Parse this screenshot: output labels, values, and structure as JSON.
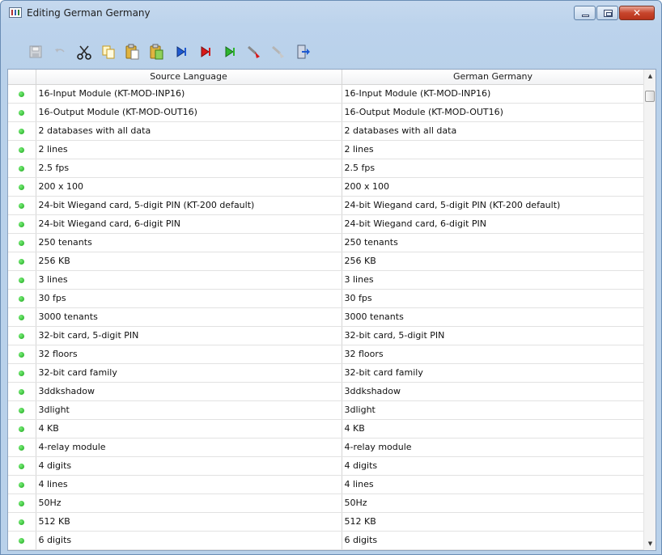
{
  "window": {
    "title": "Editing German Germany",
    "close_glyph": "✕"
  },
  "toolbar": {
    "buttons": [
      {
        "name": "save-icon",
        "enabled": false
      },
      {
        "name": "undo-icon",
        "enabled": false
      },
      {
        "name": "cut-icon",
        "enabled": true
      },
      {
        "name": "copy-icon",
        "enabled": true
      },
      {
        "name": "paste-icon",
        "enabled": true
      },
      {
        "name": "paste-special-icon",
        "enabled": true
      },
      {
        "name": "next-blue-icon",
        "enabled": true
      },
      {
        "name": "next-red-icon",
        "enabled": true
      },
      {
        "name": "next-green-icon",
        "enabled": true
      },
      {
        "name": "mark-icon",
        "enabled": true
      },
      {
        "name": "unmark-icon",
        "enabled": false
      },
      {
        "name": "exit-icon",
        "enabled": true
      }
    ]
  },
  "grid": {
    "headers": {
      "source": "Source Language",
      "target": "German Germany"
    },
    "scroll": {
      "up": "▲",
      "down": "▼"
    },
    "rows": [
      {
        "source": "16-Input Module (KT-MOD-INP16)",
        "target": "16-Input Module (KT-MOD-INP16)"
      },
      {
        "source": "16-Output Module (KT-MOD-OUT16)",
        "target": "16-Output Module (KT-MOD-OUT16)"
      },
      {
        "source": "2 databases with all data",
        "target": "2 databases with all data"
      },
      {
        "source": "2 lines",
        "target": "2 lines"
      },
      {
        "source": "2.5 fps",
        "target": "2.5 fps"
      },
      {
        "source": "200 x 100",
        "target": "200 x 100"
      },
      {
        "source": "24-bit Wiegand card, 5-digit PIN (KT-200 default)",
        "target": "24-bit Wiegand card, 5-digit PIN (KT-200 default)"
      },
      {
        "source": "24-bit Wiegand card, 6-digit PIN",
        "target": "24-bit Wiegand card, 6-digit PIN"
      },
      {
        "source": "250 tenants",
        "target": "250 tenants"
      },
      {
        "source": "256 KB",
        "target": "256 KB"
      },
      {
        "source": "3 lines",
        "target": "3 lines"
      },
      {
        "source": "30 fps",
        "target": "30 fps"
      },
      {
        "source": "3000 tenants",
        "target": "3000 tenants"
      },
      {
        "source": "32-bit card, 5-digit PIN",
        "target": "32-bit card, 5-digit PIN"
      },
      {
        "source": "32 floors",
        "target": "32 floors"
      },
      {
        "source": "32-bit card family",
        "target": "32-bit card family"
      },
      {
        "source": "3ddkshadow",
        "target": "3ddkshadow"
      },
      {
        "source": "3dlight",
        "target": "3dlight"
      },
      {
        "source": "4 KB",
        "target": "4 KB"
      },
      {
        "source": "4-relay module",
        "target": "4-relay module"
      },
      {
        "source": "4 digits",
        "target": "4 digits"
      },
      {
        "source": "4 lines",
        "target": "4 lines"
      },
      {
        "source": "50Hz",
        "target": "50Hz"
      },
      {
        "source": "512 KB",
        "target": "512 KB"
      },
      {
        "source": "6 digits",
        "target": "6 digits"
      }
    ]
  },
  "colors": {
    "status_dot": "#1aa41a",
    "close_button": "#c7452c"
  }
}
